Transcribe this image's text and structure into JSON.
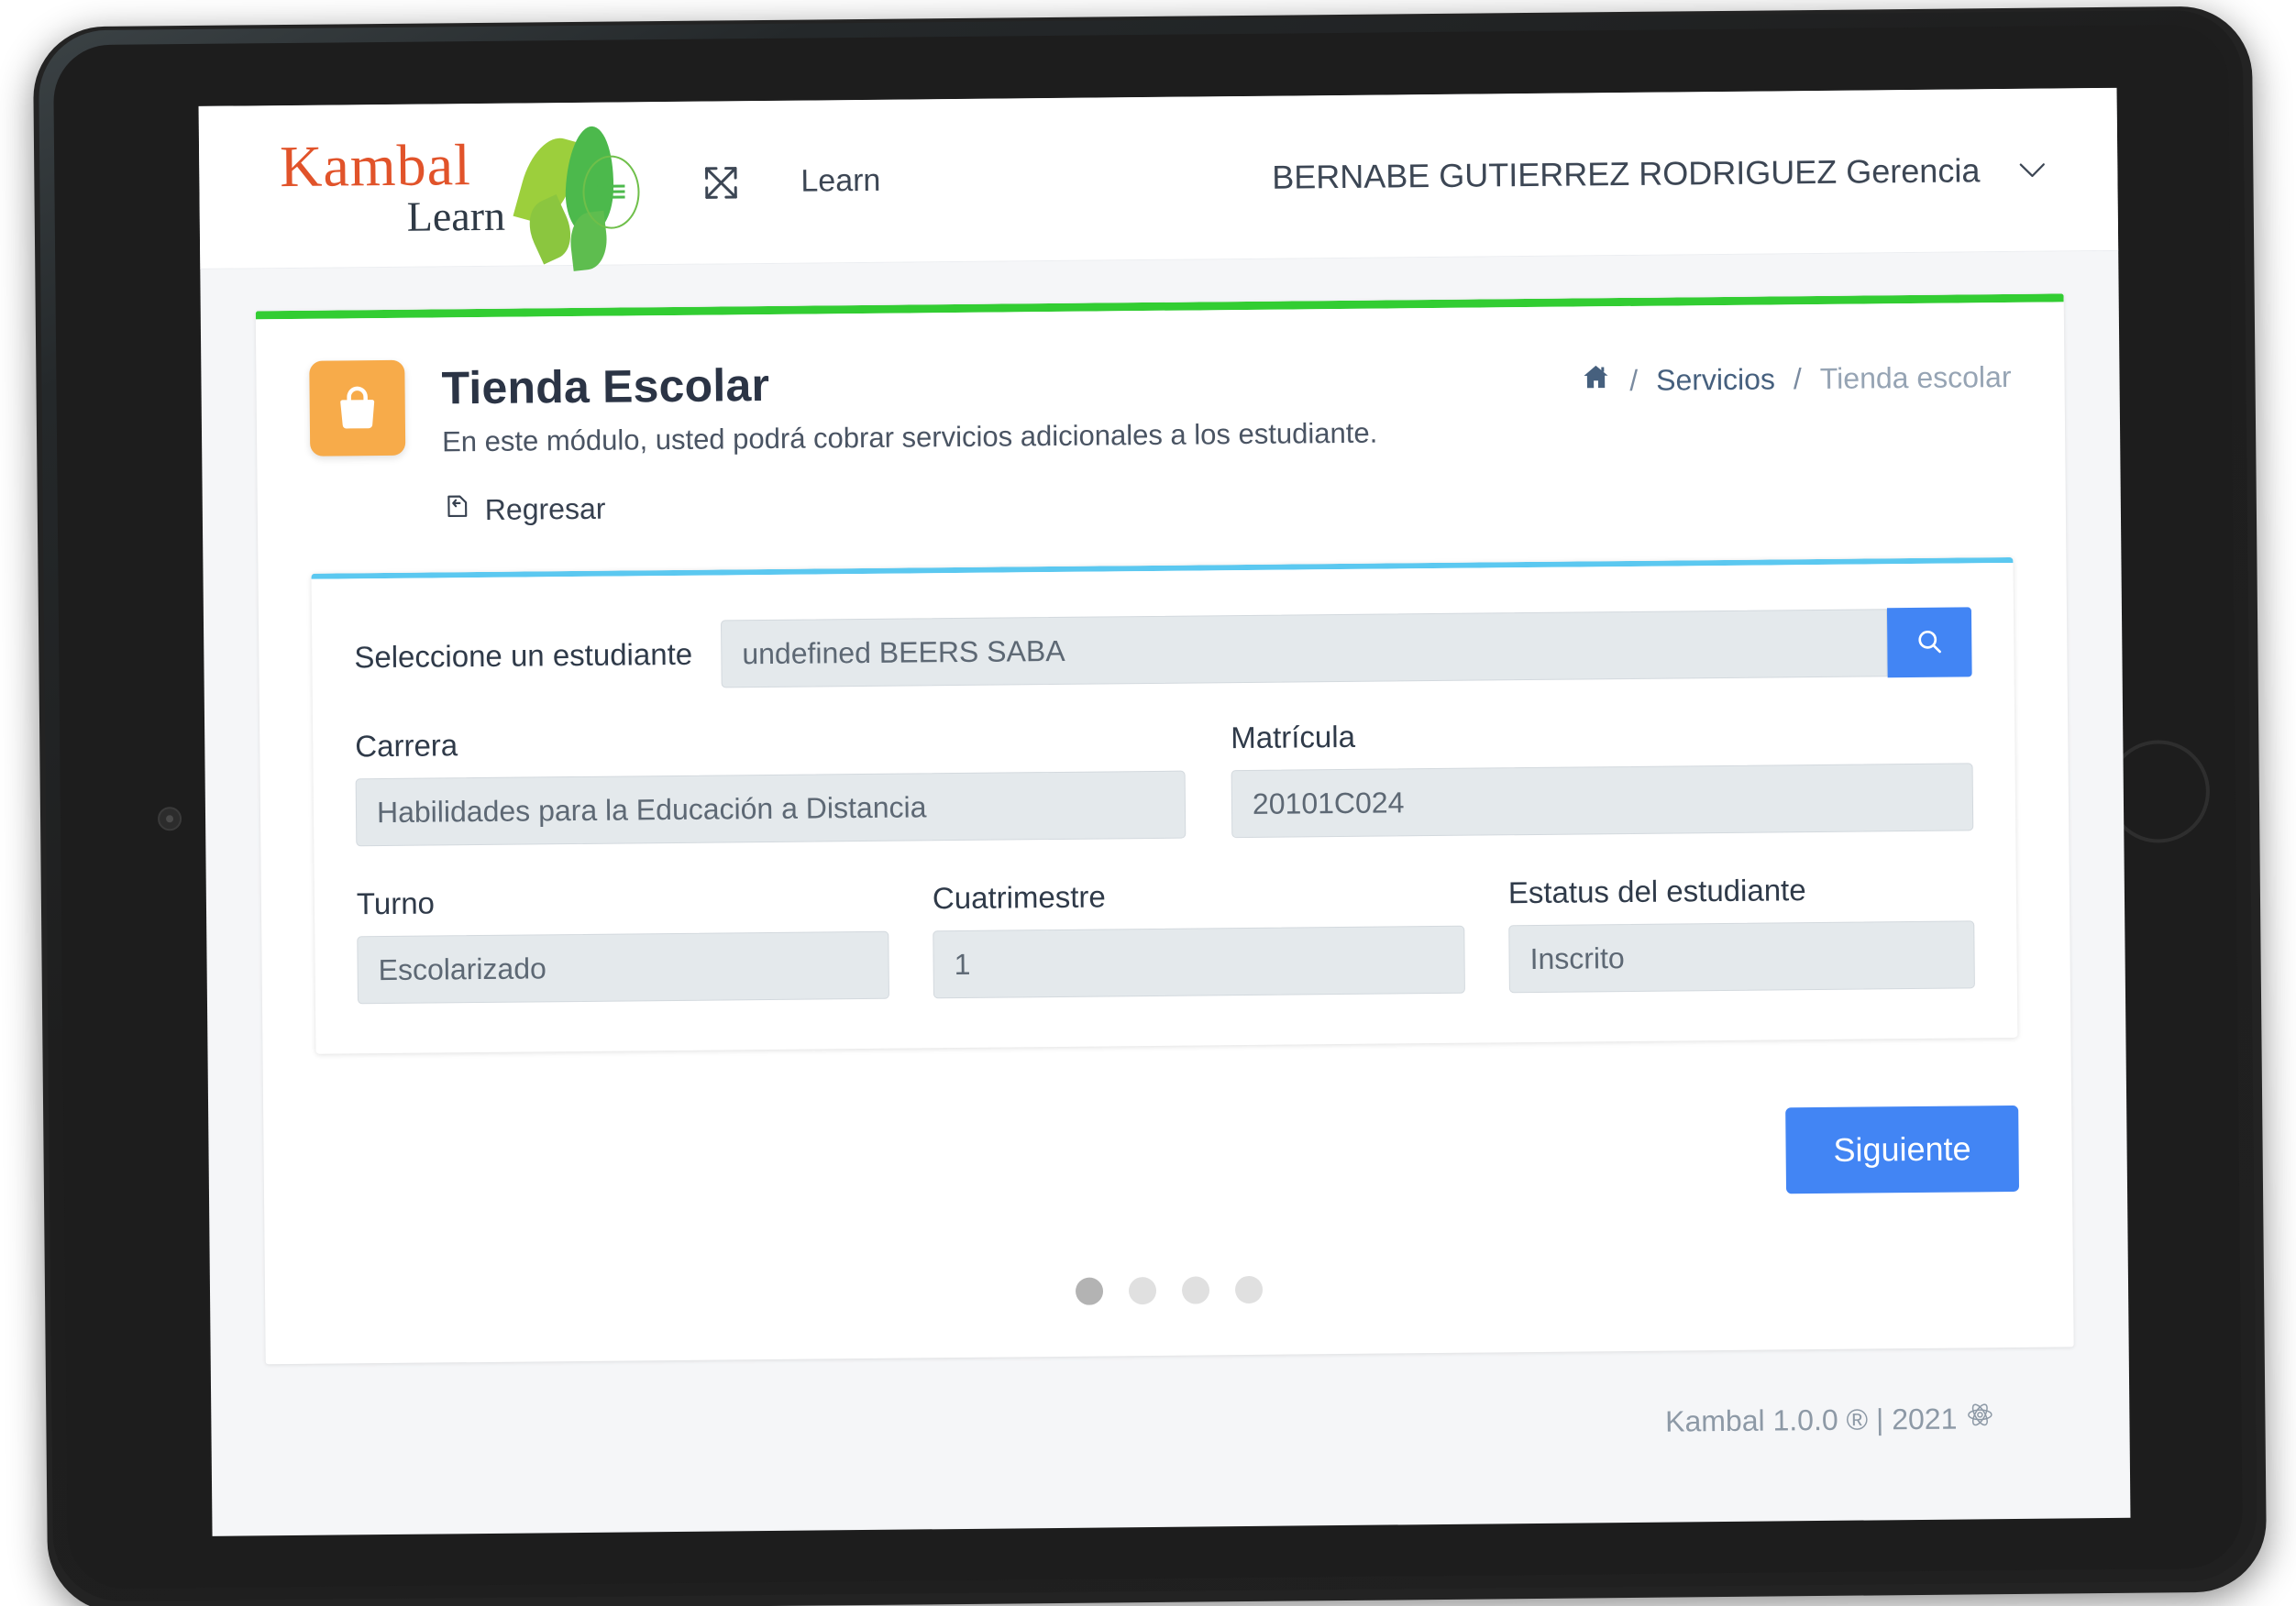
{
  "brand": {
    "word": "Kambal",
    "sub": "Learn",
    "leaf_green": "#4cb94c",
    "leaf_lime": "#9ccf3c",
    "word_color": "#e1532a"
  },
  "topbar": {
    "expand_icon": "expand-arrows-icon",
    "nav_link": "Learn",
    "user_name": "BERNABE GUTIERREZ RODRIGUEZ Gerencia",
    "chevron_icon": "chevron-down-icon"
  },
  "page": {
    "icon": "shopping-bag-icon",
    "icon_bg": "#f7ab4a",
    "accent_top": "#32cd32",
    "title": "Tienda Escolar",
    "description": "En este módulo, usted podrá cobrar servicios adicionales a los estudiante.",
    "back_label": "Regresar",
    "back_icon": "back-arrow-icon"
  },
  "breadcrumb": {
    "home_icon": "home-icon",
    "sep": "/",
    "items": [
      {
        "label": "Servicios"
      },
      {
        "label": "Tienda escolar"
      }
    ]
  },
  "form": {
    "accent_top": "#5bc8f0",
    "student": {
      "label": "Seleccione un estudiante",
      "value": "undefined BEERS SABA",
      "placeholder": "Seleccione un estudiante",
      "search_icon": "search-icon"
    },
    "carrera": {
      "label": "Carrera",
      "value": "Habilidades para la Educación a Distancia"
    },
    "matricula": {
      "label": "Matrícula",
      "value": "20101C024"
    },
    "turno": {
      "label": "Turno",
      "value": "Escolarizado"
    },
    "cuatrimestre": {
      "label": "Cuatrimestre",
      "value": "1"
    },
    "estatus": {
      "label": "Estatus del estudiante",
      "value": "Inscrito"
    }
  },
  "actions": {
    "next_label": "Siguiente",
    "next_color": "#4285f4"
  },
  "pagination": {
    "total": 4,
    "active_index": 0
  },
  "footer": {
    "text": "Kambal 1.0.0 ® | 2021",
    "icon": "react-atom-icon"
  }
}
